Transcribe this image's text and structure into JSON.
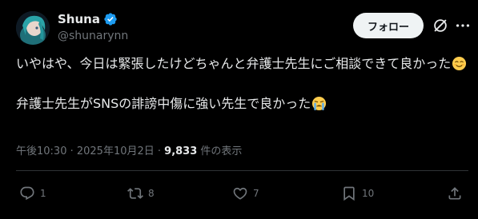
{
  "author": {
    "display_name": "Shuna",
    "handle": "@shunarynn",
    "verified_icon": "verified-badge-icon",
    "verified_color": "#1d9bf0"
  },
  "header": {
    "follow_label": "フォロー",
    "grok_icon": "grok-icon",
    "more_icon": "more-icon"
  },
  "post": {
    "line1": "いやはや、今日は緊張したけどちゃんと弁護士先生にご相談できて良かった",
    "line1_emoji": "relieved-face-emoji",
    "line2": "弁護士先生がSNSの誹謗中傷に強い先生で良かった",
    "line2_emoji": "loudly-crying-face-emoji"
  },
  "meta": {
    "timestamp": "午後10:30 · 2025年10月2日 · ",
    "views": "9,833",
    "views_label": " 件の表示"
  },
  "actions": {
    "reply_count": "1",
    "repost_count": "8",
    "like_count": "7",
    "bookmark_count": "10"
  },
  "colors": {
    "background": "#000000",
    "text": "#e7e9ea",
    "secondary": "#71767b",
    "divider": "#2f3336",
    "follow_bg": "#eff3f4"
  }
}
